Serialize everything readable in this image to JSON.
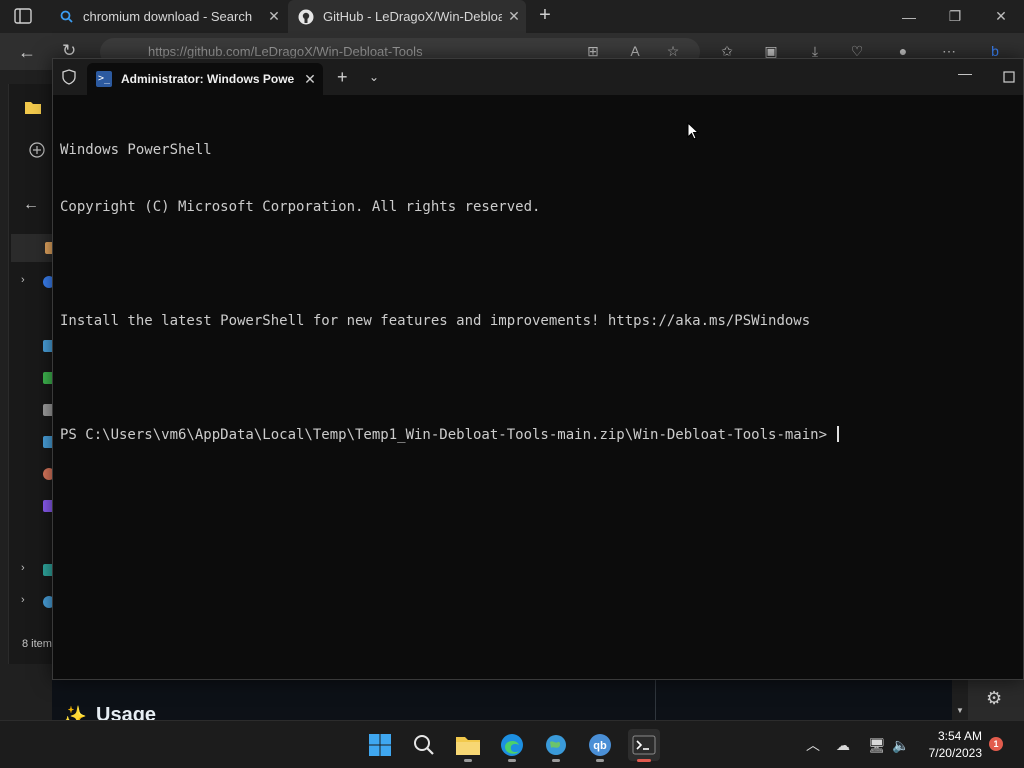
{
  "browser": {
    "tabs": [
      {
        "title": "chromium download - Search",
        "icon": "search-icon"
      },
      {
        "title": "GitHub - LeDragoX/Win-Debloat",
        "icon": "github-icon"
      }
    ],
    "address": "https://github.com/LeDragoX/Win-Debloat-Tools"
  },
  "explorer": {
    "status": "8 item"
  },
  "github": {
    "section_heading": "Usage"
  },
  "terminal": {
    "tab_title": "Administrator: Windows Powe",
    "lines": [
      "Windows PowerShell",
      "Copyright (C) Microsoft Corporation. All rights reserved.",
      "",
      "Install the latest PowerShell for new features and improvements! https://aka.ms/PSWindows",
      "",
      "PS C:\\Users\\vm6\\AppData\\Local\\Temp\\Temp1_Win-Debloat-Tools-main.zip\\Win-Debloat-Tools-main> "
    ]
  },
  "taskbar": {
    "apps": [
      "start-button",
      "search-button",
      "file-explorer",
      "edge",
      "globe-app",
      "qbittorrent",
      "terminal"
    ],
    "time": "3:54 AM",
    "date": "7/20/2023",
    "notification_count": "1"
  },
  "colors": {
    "terminal_bg": "#0c0c0c",
    "terminal_text": "#cccccc",
    "taskbar_bg": "#1c1c1c",
    "accent": "#0078d4"
  }
}
